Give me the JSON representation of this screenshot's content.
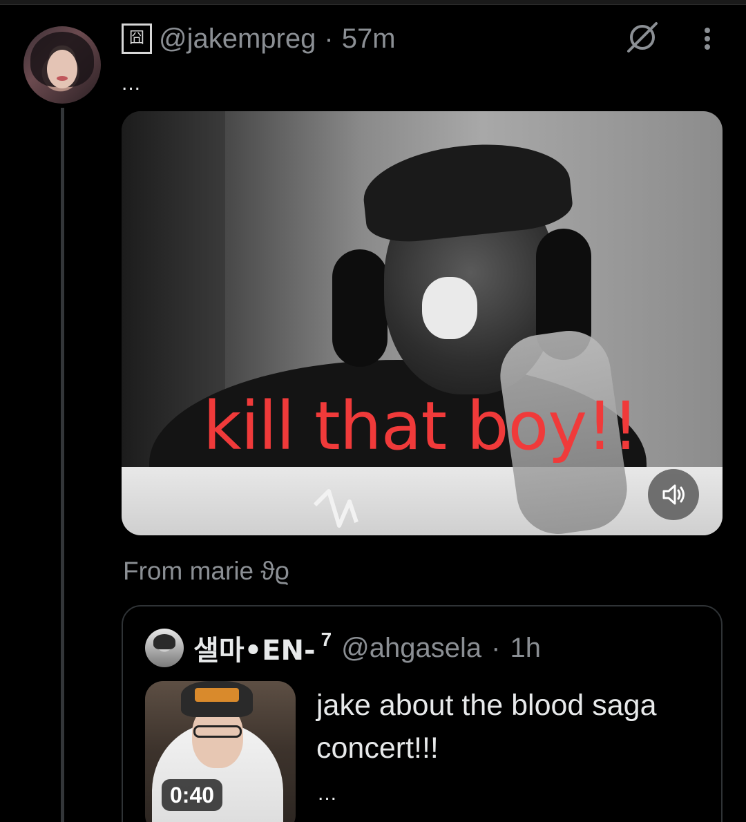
{
  "tweet": {
    "handle_glyph": "囧",
    "handle": "@jakempreg",
    "separator": "·",
    "time": "57m",
    "text_ellipsis": "...",
    "avatar_icon": "profile-photo",
    "action_icons": [
      "grok-icon",
      "more-options-icon"
    ]
  },
  "video": {
    "caption": "kill that boy!!",
    "caption_color": "#f03a3a",
    "volume_icon": "speaker-icon"
  },
  "attribution": {
    "label": "From marie ϑϱ"
  },
  "quote": {
    "name": "샐마•EN-",
    "name_superscript": "7",
    "handle": "@ahgasela",
    "separator": "·",
    "time": "1h",
    "thumbnail_duration": "0:40",
    "text": "jake about the blood saga concert!!!",
    "more": "..."
  },
  "colors": {
    "background": "#000000",
    "primary_text": "#e7e9ea",
    "secondary_text": "#8b8f94",
    "border": "#2f3336"
  }
}
